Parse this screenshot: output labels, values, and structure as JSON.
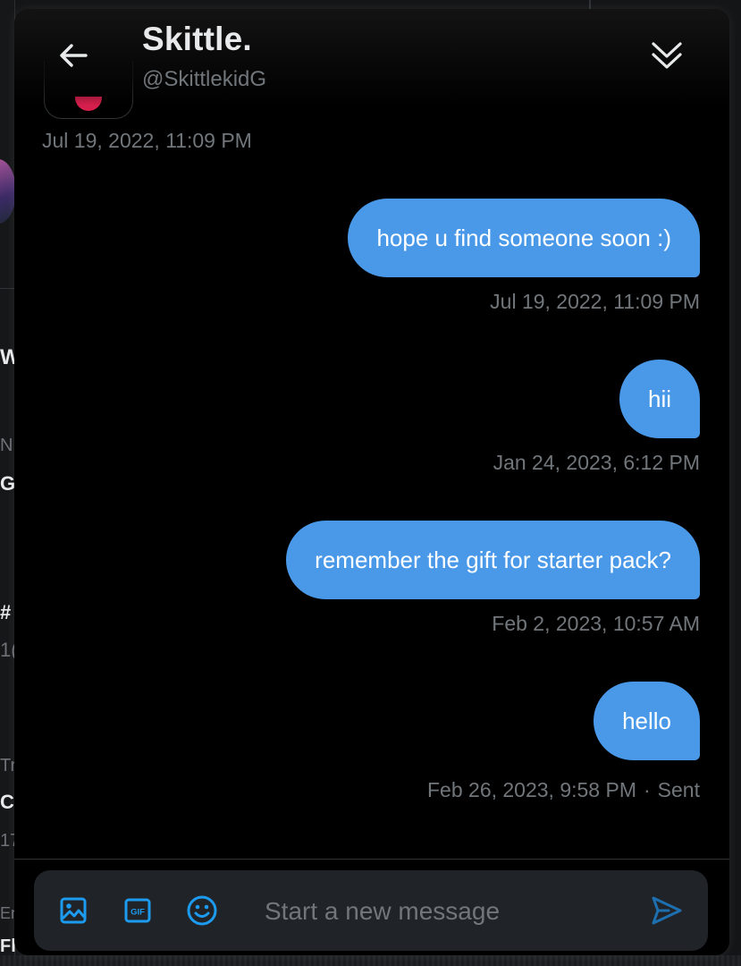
{
  "conversation": {
    "display_name": "Skittle.",
    "handle": "@SkittlekidG",
    "earlier_timestamp": "Jul 19, 2022, 11:09 PM"
  },
  "messages": [
    {
      "text": "hope u find someone soon :)",
      "timestamp": "Jul 19, 2022, 11:09 PM"
    },
    {
      "text": "hii",
      "timestamp": "Jan 24, 2023, 6:12 PM"
    },
    {
      "text": "remember the gift for starter pack?",
      "timestamp": "Feb 2, 2023, 10:57 AM"
    },
    {
      "text": "hello",
      "timestamp": "Feb 26, 2023, 9:58 PM",
      "separator": "·",
      "status": "Sent"
    }
  ],
  "composer": {
    "placeholder": "Start a new message",
    "tools": [
      "media-icon",
      "gif-icon",
      "emoji-icon"
    ],
    "gif_label": "GIF",
    "send_icon": "send-icon"
  },
  "icons": {
    "back": "arrow-left-icon",
    "collapse": "double-chevron-down-icon"
  },
  "background_feed": {
    "glyphs": [
      "W",
      "N",
      "G",
      "#",
      "1(",
      "Tr",
      "C",
      "17",
      "Er",
      "Fl"
    ]
  },
  "colors": {
    "accent": "#1d9bf0",
    "bubble": "#4a99e9",
    "muted_text": "#71767b",
    "primary_text": "#e7e9ea",
    "composer_bg": "#202327"
  }
}
